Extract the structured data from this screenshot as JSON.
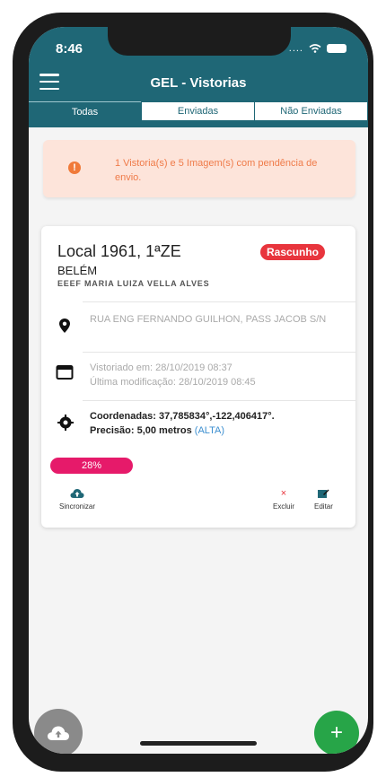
{
  "status_bar": {
    "time": "8:46",
    "dots": "...."
  },
  "header": {
    "title": "GEL - Vistorias"
  },
  "tabs": [
    {
      "label": "Todas"
    },
    {
      "label": "Enviadas"
    },
    {
      "label": "Não Enviadas"
    }
  ],
  "alert": {
    "text": "1 Vistoria(s) e 5 Imagem(s) com pendência de envio."
  },
  "card": {
    "title": "Local 1961, 1ªZE",
    "badge": "Rascunho",
    "city": "BELÉM",
    "school": "EEEF MARIA LUIZA VELLA ALVES",
    "address": "RUA ENG FERNANDO GUILHON, PASS JACOB S/N",
    "inspected_at": "Vistoriado em: 28/10/2019 08:37",
    "modified_at": "Última modificação: 28/10/2019 08:45",
    "coordinates": "Coordenadas: 37,785834°,-122,406417°.",
    "precision_label": "Precisão: 5,00 metros",
    "precision_level": "(ALTA)",
    "progress": {
      "label": "28%",
      "value": 0.28
    },
    "actions": {
      "sync": "Sincronizar",
      "delete": "Excluir",
      "edit": "Editar"
    }
  },
  "fab": {
    "add": "+"
  },
  "colors": {
    "primary": "#1f6776",
    "badge": "#e8353d",
    "progress": "#e61a6a",
    "alert_bg": "#fde4da",
    "alert_text": "#ef7b49",
    "fab_add": "#27a548"
  },
  "icons": [
    "menu-icon",
    "wifi-icon",
    "battery-icon",
    "alert-icon",
    "location-pin-icon",
    "calendar-icon",
    "gps-target-icon",
    "cloud-upload-icon",
    "delete-icon",
    "edit-icon",
    "add-icon"
  ]
}
